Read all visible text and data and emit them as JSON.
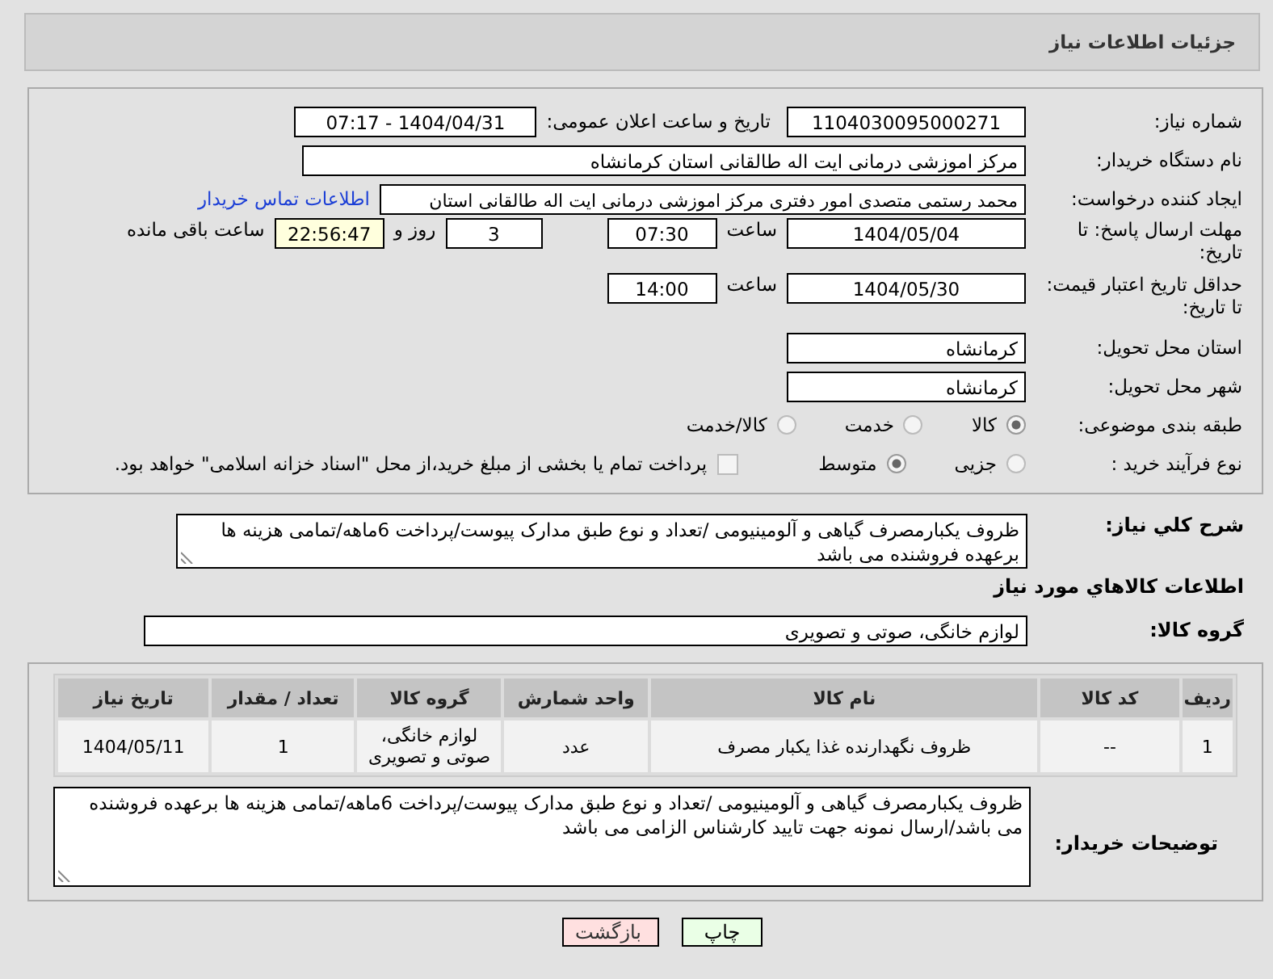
{
  "page_title": "جزئیات اطلاعات نیاز",
  "need_number": {
    "label": "شماره نیاز:",
    "value": "1104030095000271"
  },
  "announce": {
    "label": "تاریخ و ساعت اعلان عمومی:",
    "value": "1404/04/31 - 07:17"
  },
  "buyer_org": {
    "label": "نام دستگاه خریدار:",
    "value": "مرکز اموزشی درمانی ایت اله طالقانی استان کرمانشاه"
  },
  "requester": {
    "label": "ایجاد کننده درخواست:",
    "value": "محمد رستمی متصدی امور دفتری مرکز اموزشی درمانی ایت اله طالقانی استان",
    "link": "اطلاعات تماس خریدار"
  },
  "reply_deadline": {
    "label": "مهلت ارسال پاسخ: تا تاریخ:",
    "date": "1404/05/04",
    "time_label": "ساعت",
    "time": "07:30",
    "days": "3",
    "days_label": "روز و",
    "remaining": "22:56:47",
    "remaining_label": "ساعت باقی مانده"
  },
  "price_validity": {
    "label": "حداقل تاریخ اعتبار قیمت: تا تاریخ:",
    "date": "1404/05/30",
    "time_label": "ساعت",
    "time": "14:00"
  },
  "delivery_province": {
    "label": "استان محل تحویل:",
    "value": "کرمانشاه"
  },
  "delivery_city": {
    "label": "شهر محل تحویل:",
    "value": "کرمانشاه"
  },
  "category": {
    "label": "طبقه بندی موضوعی:",
    "options": [
      {
        "label": "کالا",
        "selected": true
      },
      {
        "label": "خدمت",
        "selected": false
      },
      {
        "label": "کالا/خدمت",
        "selected": false
      }
    ]
  },
  "purchase_type": {
    "label": "نوع فرآیند خرید :",
    "options": [
      {
        "label": "جزیی",
        "selected": false
      },
      {
        "label": "متوسط",
        "selected": true
      }
    ],
    "payment_note": {
      "checked": false,
      "text": "پرداخت تمام یا بخشی از مبلغ خرید،از محل \"اسناد خزانه اسلامی\" خواهد بود."
    }
  },
  "description": {
    "label": "شرح کلي نیاز:",
    "value": "ظروف یکبارمصرف گیاهی و آلومینیومی /تعداد و نوع طبق مدارک پیوست/پرداخت 6ماهه/تمامی هزینه ها برعهده فروشنده می باشد"
  },
  "goods_heading": "اطلاعات كالاهاي مورد نیاز",
  "goods_group": {
    "label": "گروه کالا:",
    "value": "لوازم خانگی، صوتی و تصویری"
  },
  "table": {
    "columns": [
      "ردیف",
      "کد کالا",
      "نام کالا",
      "واحد شمارش",
      "گروه کالا",
      "تعداد / مقدار",
      "تاریخ نیاز"
    ],
    "rows": [
      [
        "1",
        "--",
        "ظروف نگهدارنده غذا یکبار مصرف",
        "عدد",
        "لوازم خانگی، صوتی و تصویری",
        "1",
        "1404/05/11"
      ]
    ]
  },
  "buyer_notes": {
    "label": "توضیحات خریدار:",
    "value": "ظروف یکبارمصرف گیاهی و آلومینیومی /تعداد و نوع طبق مدارک پیوست/پرداخت 6ماهه/تمامی هزینه ها برعهده فروشنده می باشد/ارسال نمونه جهت تایید کارشناس الزامی می باشد"
  },
  "buttons": [
    {
      "label": "چاپ",
      "kind": "print"
    },
    {
      "label": "بازگشت",
      "kind": "back"
    }
  ]
}
